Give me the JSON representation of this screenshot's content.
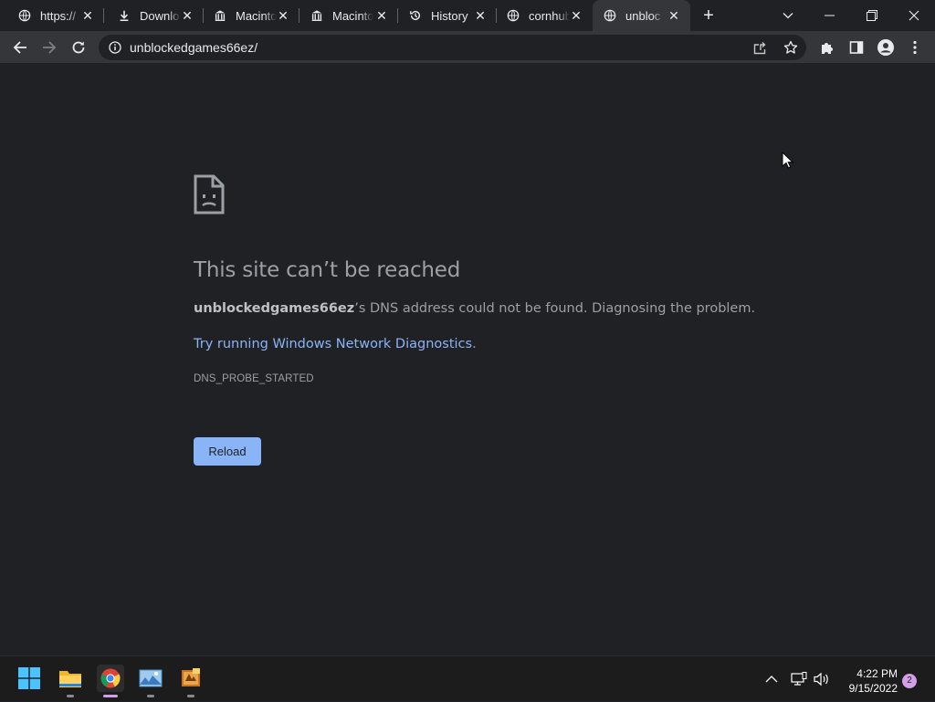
{
  "tabs": [
    {
      "label": "https://",
      "icon": "globe-icon",
      "active": false
    },
    {
      "label": "Downlo",
      "icon": "download-icon",
      "active": false
    },
    {
      "label": "Macinto",
      "icon": "bank-icon",
      "active": false
    },
    {
      "label": "Macinto",
      "icon": "bank-icon",
      "active": false
    },
    {
      "label": "History",
      "icon": "history-icon",
      "active": false
    },
    {
      "label": "cornhub",
      "icon": "globe-icon",
      "active": false
    },
    {
      "label": "unbloc",
      "icon": "globe-icon",
      "active": true
    }
  ],
  "address_bar": {
    "url": "unblockedgames66ez/"
  },
  "error_page": {
    "headline": "This site can’t be reached",
    "host": "unblockedgames66ez",
    "description_rest": "’s DNS address could not be found. Diagnosing the problem.",
    "suggestion_link": "Try running Windows Network Diagnostics",
    "suggestion_tail": ".",
    "error_code": "DNS_PROBE_STARTED",
    "reload_label": "Reload"
  },
  "taskbar": {
    "apps": [
      "windows-start-icon",
      "file-explorer-icon",
      "chrome-icon",
      "photos-icon",
      "app-icon"
    ],
    "active_app": "chrome-icon",
    "time": "4:22 PM",
    "date": "9/15/2022",
    "notification_count": "2"
  },
  "colors": {
    "background": "#202124",
    "toolbar": "#35363a",
    "link": "#8ab4f8",
    "button": "#8ab4f8",
    "text_muted": "#9aa0a6",
    "taskbar": "#1c1c1c",
    "notification_badge": "#d49ee8"
  }
}
